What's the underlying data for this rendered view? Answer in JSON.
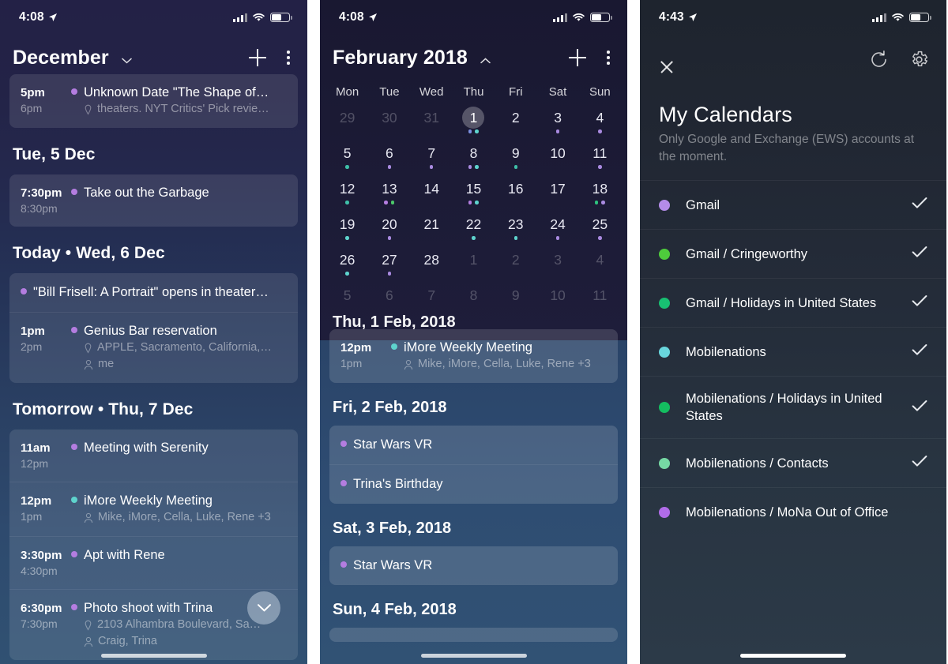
{
  "panels": {
    "agenda": {
      "status": {
        "time": "4:08"
      },
      "nav": {
        "title": "December",
        "chevron": "chevron-down",
        "add": "+",
        "more": "overflow-menu"
      },
      "groups": [
        {
          "header": null,
          "clipped": true,
          "events": [
            {
              "start": "5pm",
              "end": "6pm",
              "title": "Unknown Date \"The Shape of…",
              "dot": "#b47de0",
              "sub": [
                {
                  "icon": "location",
                  "text": "theaters. NYT Critics' Pick revie…"
                }
              ]
            }
          ]
        },
        {
          "header": "Tue, 5 Dec",
          "events": [
            {
              "start": "7:30pm",
              "end": "8:30pm",
              "title": "Take out the Garbage",
              "dot": "#b47de0",
              "sub": []
            }
          ]
        },
        {
          "header": "Today • Wed, 6 Dec",
          "events": [
            {
              "start": "",
              "end": "",
              "title": "\"Bill Frisell: A Portrait\" opens in theater…",
              "dot": "#b47de0",
              "sub": [],
              "allday": true
            },
            {
              "start": "1pm",
              "end": "2pm",
              "title": "Genius Bar reservation",
              "dot": "#b47de0",
              "sub": [
                {
                  "icon": "location",
                  "text": "APPLE, Sacramento, California,…"
                },
                {
                  "icon": "person",
                  "text": "me"
                }
              ]
            }
          ]
        },
        {
          "header": "Tomorrow • Thu, 7 Dec",
          "events": [
            {
              "start": "11am",
              "end": "12pm",
              "title": "Meeting with Serenity",
              "dot": "#b47de0",
              "sub": []
            },
            {
              "start": "12pm",
              "end": "1pm",
              "title": "iMore Weekly Meeting",
              "dot": "#5ed3cd",
              "sub": [
                {
                  "icon": "person",
                  "text": "Mike, iMore, Cella, Luke, Rene +3"
                }
              ]
            },
            {
              "start": "3:30pm",
              "end": "4:30pm",
              "title": "Apt with Rene",
              "dot": "#b47de0",
              "sub": []
            },
            {
              "start": "6:30pm",
              "end": "7:30pm",
              "title": "Photo shoot with Trina",
              "dot": "#b47de0",
              "sub": [
                {
                  "icon": "location",
                  "text": "2103 Alhambra Boulevard, Sa…"
                },
                {
                  "icon": "person",
                  "text": "Craig, Trina"
                }
              ]
            }
          ]
        }
      ],
      "fab": "scroll-down-fab"
    },
    "month": {
      "status": {
        "time": "4:08"
      },
      "nav": {
        "title": "February 2018",
        "chevron": "chevron-up",
        "add": "+",
        "more": "overflow-menu"
      },
      "weekdays": [
        "Mon",
        "Tue",
        "Wed",
        "Thu",
        "Fri",
        "Sat",
        "Sun"
      ],
      "weeks": [
        [
          {
            "n": "29",
            "muted": true,
            "dots": []
          },
          {
            "n": "30",
            "muted": true,
            "dots": []
          },
          {
            "n": "31",
            "muted": true,
            "dots": []
          },
          {
            "n": "1",
            "today": true,
            "dots": [
              "#7b8fe0",
              "#5ed3cd"
            ]
          },
          {
            "n": "2",
            "dots": []
          },
          {
            "n": "3",
            "dots": [
              "#a98ae0"
            ]
          },
          {
            "n": "4",
            "dots": [
              "#a98ae0"
            ]
          }
        ],
        [
          {
            "n": "5",
            "dots": [
              "#3fbfa8"
            ]
          },
          {
            "n": "6",
            "dots": [
              "#a98ae0"
            ]
          },
          {
            "n": "7",
            "dots": [
              "#a98ae0"
            ]
          },
          {
            "n": "8",
            "dots": [
              "#a98ae0",
              "#5ed3cd"
            ]
          },
          {
            "n": "9",
            "dots": [
              "#3fbfa8"
            ]
          },
          {
            "n": "10",
            "dots": []
          },
          {
            "n": "11",
            "dots": [
              "#a98ae0"
            ]
          }
        ],
        [
          {
            "n": "12",
            "dots": [
              "#3fbfa8"
            ]
          },
          {
            "n": "13",
            "dots": [
              "#b47de0",
              "#4cc96a"
            ]
          },
          {
            "n": "14",
            "dots": []
          },
          {
            "n": "15",
            "dots": [
              "#b47de0",
              "#5ed3cd"
            ]
          },
          {
            "n": "16",
            "dots": []
          },
          {
            "n": "17",
            "dots": []
          },
          {
            "n": "18",
            "dots": [
              "#2ec27e",
              "#a98ae0"
            ]
          }
        ],
        [
          {
            "n": "19",
            "dots": [
              "#5ed3cd"
            ]
          },
          {
            "n": "20",
            "dots": [
              "#a98ae0"
            ]
          },
          {
            "n": "21",
            "dots": []
          },
          {
            "n": "22",
            "dots": [
              "#5ed3cd"
            ]
          },
          {
            "n": "23",
            "dots": [
              "#5ed3cd"
            ]
          },
          {
            "n": "24",
            "dots": [
              "#a98ae0"
            ]
          },
          {
            "n": "25",
            "dots": [
              "#a98ae0"
            ]
          }
        ],
        [
          {
            "n": "26",
            "dots": [
              "#5ed3cd"
            ]
          },
          {
            "n": "27",
            "dots": [
              "#a98ae0"
            ]
          },
          {
            "n": "28",
            "dots": []
          },
          {
            "n": "1",
            "muted": true,
            "dots": []
          },
          {
            "n": "2",
            "muted": true,
            "dots": []
          },
          {
            "n": "3",
            "muted": true,
            "dots": []
          },
          {
            "n": "4",
            "muted": true,
            "dots": []
          }
        ],
        [
          {
            "n": "5",
            "muted": true,
            "dots": []
          },
          {
            "n": "6",
            "muted": true,
            "dots": []
          },
          {
            "n": "7",
            "muted": true,
            "dots": []
          },
          {
            "n": "8",
            "muted": true,
            "dots": []
          },
          {
            "n": "9",
            "muted": true,
            "dots": []
          },
          {
            "n": "10",
            "muted": true,
            "dots": []
          },
          {
            "n": "11",
            "muted": true,
            "dots": []
          }
        ]
      ],
      "groups": [
        {
          "header": "Thu, 1 Feb, 2018",
          "clipped": true,
          "events": [
            {
              "start": "12pm",
              "end": "1pm",
              "title": "iMore Weekly Meeting",
              "dot": "#5ed3cd",
              "sub": [
                {
                  "icon": "person",
                  "text": "Mike, iMore, Cella, Luke, Rene +3"
                }
              ]
            }
          ]
        },
        {
          "header": "Fri, 2 Feb, 2018",
          "events": [
            {
              "title": "Star Wars VR",
              "dot": "#b47de0",
              "allday": true,
              "sub": []
            },
            {
              "title": "Trina's Birthday",
              "dot": "#b47de0",
              "allday": true,
              "sub": []
            }
          ]
        },
        {
          "header": "Sat, 3 Feb, 2018",
          "events": [
            {
              "title": "Star Wars VR",
              "dot": "#b47de0",
              "allday": true,
              "sub": []
            }
          ]
        },
        {
          "header": "Sun, 4 Feb, 2018",
          "events": []
        }
      ]
    },
    "calendars": {
      "status": {
        "time": "4:43"
      },
      "nav": {
        "close": "close-icon",
        "sync": "sync-icon",
        "settings": "gear-icon"
      },
      "title": "My Calendars",
      "subtitle": "Only Google and Exchange (EWS) accounts at the moment.",
      "items": [
        {
          "label": "Gmail",
          "color": "#b48ce8",
          "checked": true
        },
        {
          "label": "Gmail / Cringeworthy",
          "color": "#4ecb3c",
          "checked": true
        },
        {
          "label": "Gmail / Holidays in United States",
          "color": "#18bf72",
          "checked": true
        },
        {
          "label": "Mobilenations",
          "color": "#69d6dd",
          "checked": true
        },
        {
          "label": "Mobilenations / Holidays in United States",
          "color": "#14bd60",
          "checked": true
        },
        {
          "label": "Mobilenations / Contacts",
          "color": "#76d8a4",
          "checked": true
        },
        {
          "label": "Mobilenations / MoNa Out of Office",
          "color": "#b06ce8",
          "checked": false
        }
      ]
    }
  }
}
